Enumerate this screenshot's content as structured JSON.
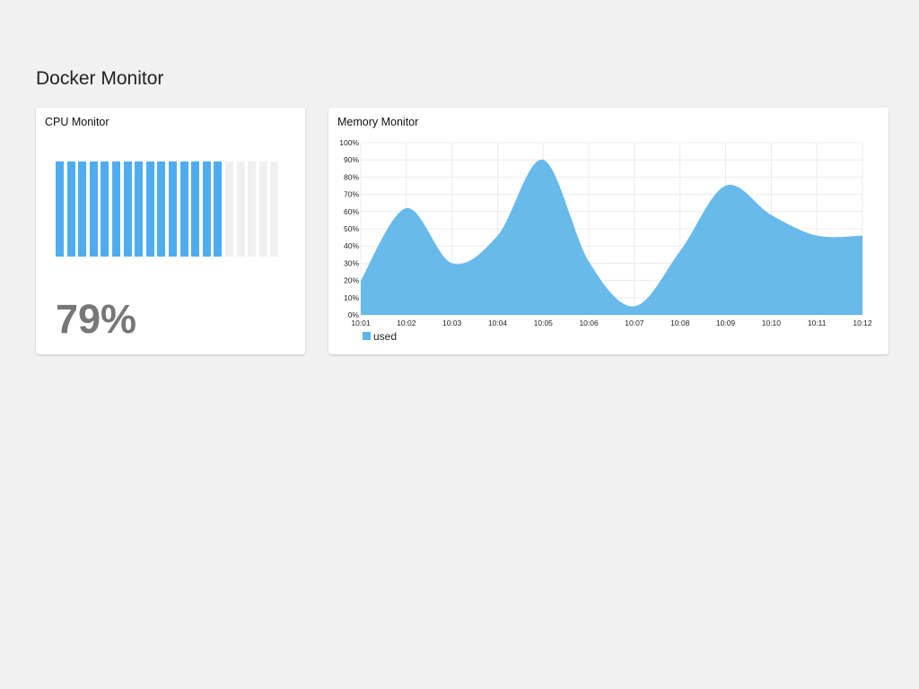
{
  "header": {
    "title": "Docker Monitor"
  },
  "cpu": {
    "title": "CPU Monitor",
    "percent_text": "79%",
    "total_bars": 20,
    "filled_bars": 15,
    "filled_color": "#4fadef",
    "empty_color": "#f0f0f0"
  },
  "memory": {
    "title": "Memory Monitor",
    "chart_data": {
      "type": "area",
      "x": [
        "10:01",
        "10:02",
        "10:03",
        "10:04",
        "10:05",
        "10:06",
        "10:07",
        "10:08",
        "10:09",
        "10:10",
        "10:11",
        "10:12"
      ],
      "series": [
        {
          "name": "used",
          "values": [
            20,
            62,
            30,
            46,
            90,
            31,
            5,
            37,
            75,
            58,
            46,
            46
          ],
          "color": "#5ab4e8"
        }
      ],
      "yticks": [
        "0%",
        "10%",
        "20%",
        "30%",
        "40%",
        "50%",
        "60%",
        "70%",
        "80%",
        "90%",
        "100%"
      ],
      "ylim": [
        0,
        100
      ],
      "grid": true,
      "legend": "bottom-left"
    }
  }
}
